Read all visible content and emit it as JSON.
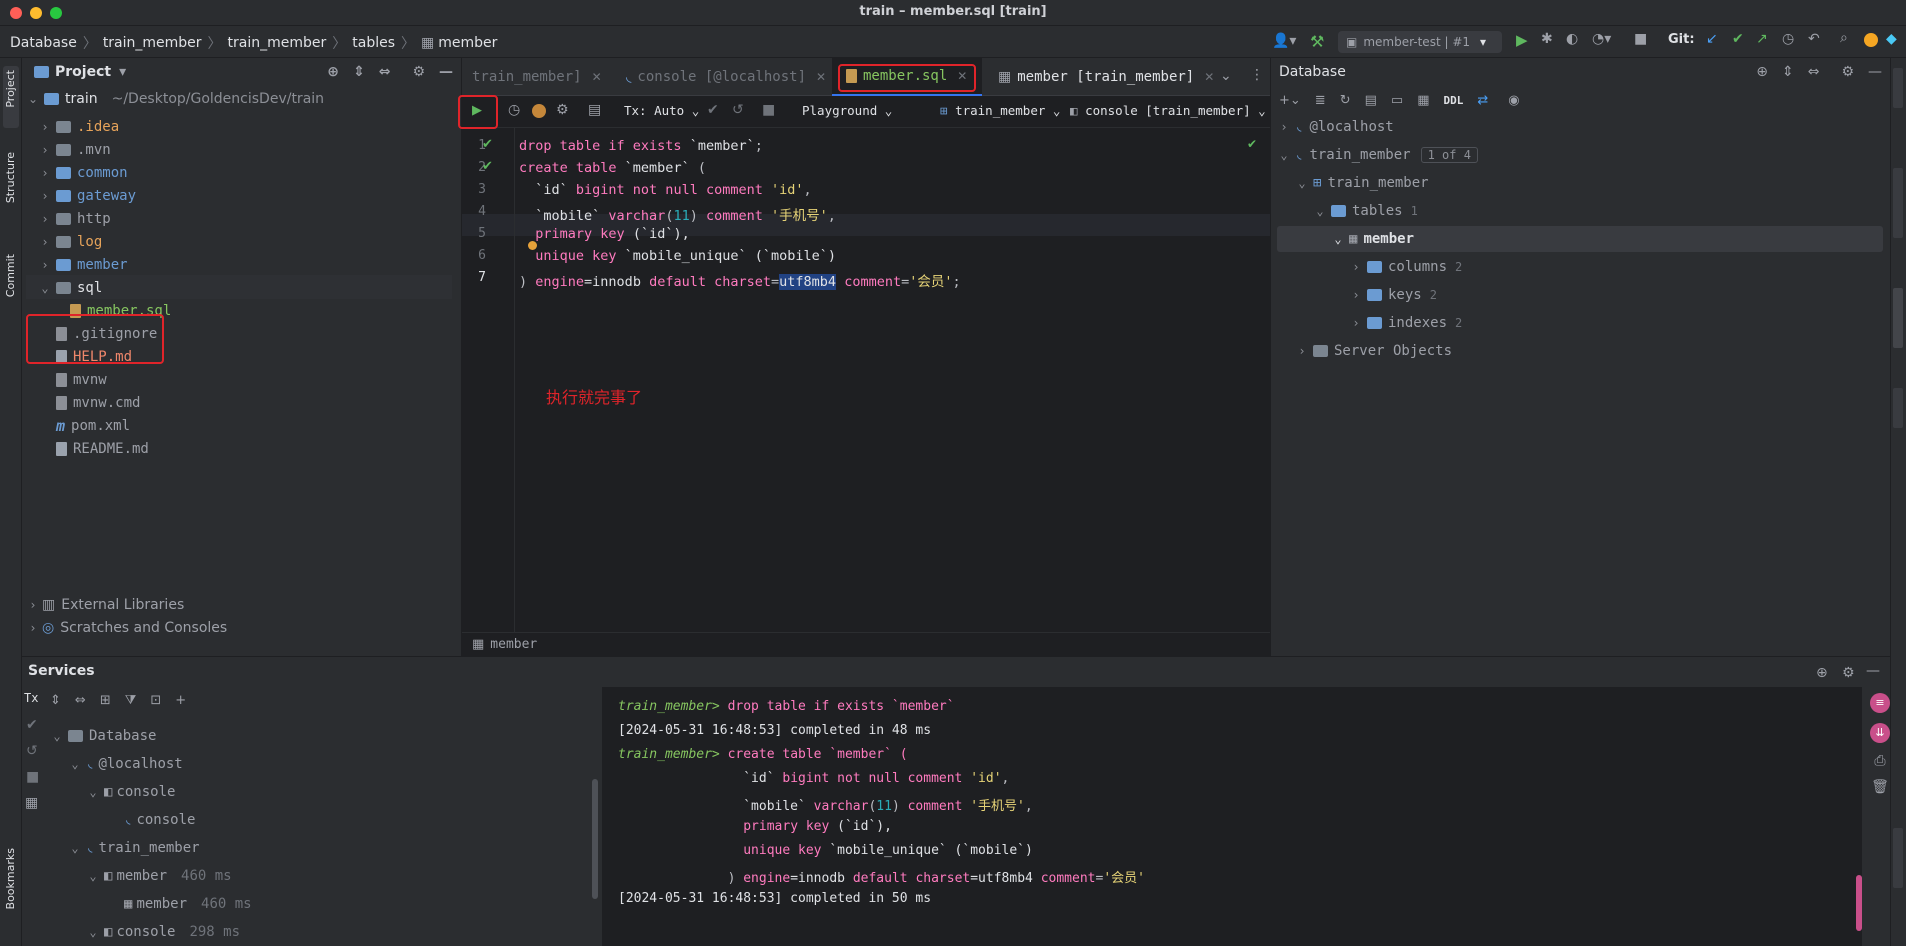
{
  "window": {
    "title": "train – member.sql [train]",
    "traffic_colors": [
      "#ff5f57",
      "#febc2e",
      "#28c840"
    ]
  },
  "navbar": {
    "breadcrumb": [
      "Database",
      "train_member",
      "train_member",
      "tables",
      "member"
    ],
    "run_config": "member-test | #1",
    "git_label": "Git:"
  },
  "left_stripe": {
    "project": "Project",
    "structure": "Structure",
    "commit": "Commit",
    "bookmarks": "Bookmarks"
  },
  "project": {
    "header": "Project",
    "root_name": "train",
    "root_path": "~/Desktop/GoldencisDev/train",
    "items": [
      {
        "label": "idea",
        "display": ".idea",
        "type": "folder",
        "color": "#e6a35a"
      },
      {
        "label": "mvn",
        "display": ".mvn",
        "type": "folder",
        "color": "#9da0a8"
      },
      {
        "label": "common",
        "display": "common",
        "type": "folder",
        "color": "#6b9bd2"
      },
      {
        "label": "gateway",
        "display": "gateway",
        "type": "folder",
        "color": "#6b9bd2"
      },
      {
        "label": "http",
        "display": "http",
        "type": "folder",
        "color": "#9da0a8"
      },
      {
        "label": "log",
        "display": "log",
        "type": "folder",
        "color": "#e6a35a"
      },
      {
        "label": "member",
        "display": "member",
        "type": "folder",
        "color": "#6b9bd2"
      },
      {
        "label": "sql",
        "display": "sql",
        "type": "folder",
        "color": "#dfe1e5"
      },
      {
        "label": "member.sql",
        "display": "member.sql",
        "type": "sqlfile",
        "color": "#86c560"
      },
      {
        "label": "gitignore",
        "display": ".gitignore",
        "type": "file",
        "color": "#9da0a8"
      },
      {
        "label": "HELP.md",
        "display": "HELP.md",
        "type": "md",
        "color": "#f0876b"
      },
      {
        "label": "mvnw",
        "display": "mvnw",
        "type": "file",
        "color": "#9da0a8"
      },
      {
        "label": "mvnw.cmd",
        "display": "mvnw.cmd",
        "type": "file",
        "color": "#9da0a8"
      },
      {
        "label": "pom.xml",
        "display": "pom.xml",
        "type": "m",
        "color": "#9da0a8"
      },
      {
        "label": "README.md",
        "display": "README.md",
        "type": "md",
        "color": "#9da0a8"
      }
    ],
    "external_libraries": "External Libraries",
    "scratches": "Scratches and Consoles"
  },
  "editor": {
    "tabs": [
      {
        "label": "train_member]"
      },
      {
        "label": "console [@localhost]"
      },
      {
        "label": "member.sql"
      },
      {
        "label": "member [train_member]"
      }
    ],
    "toolbar": {
      "tx": "Tx: Auto",
      "playground": "Playground",
      "schema": "train_member",
      "session": "console [train_member]"
    },
    "line_numbers": [
      "1",
      "2",
      "3",
      "4",
      "5",
      "6",
      "7"
    ],
    "annotation": "执行就完事了",
    "breadcrumb_bottom": "member"
  },
  "code": {
    "l1": [
      "drop table if exists ",
      "`member`",
      ";"
    ],
    "l2": [
      "create table ",
      "`member`",
      " ("
    ],
    "l3": [
      "  `id` ",
      "bigint not null comment ",
      "'id'",
      ","
    ],
    "l4": [
      "  `mobile` ",
      "varchar",
      "(",
      "11",
      ") ",
      "comment ",
      "'手机号'",
      ","
    ],
    "l5": [
      "  ",
      "primary key ",
      "(`id`),"
    ],
    "l6": [
      "  ",
      "unique key ",
      "`mobile_unique` (`mobile`)"
    ],
    "l7": [
      ") ",
      "engine",
      "=innodb ",
      "default charset",
      "=",
      "utf8mb4",
      " ",
      "comment",
      "=",
      "'会员'",
      ";"
    ]
  },
  "database": {
    "header": "Database",
    "ddl": "DDL",
    "localhost": "@localhost",
    "train_member": "train_member",
    "badge": "1 of 4",
    "schema": "train_member",
    "tables": "tables",
    "tables_count": "1",
    "member": "member",
    "columns": "columns",
    "columns_count": "2",
    "keys": "keys",
    "keys_count": "2",
    "indexes": "indexes",
    "indexes_count": "2",
    "server_objects": "Server Objects"
  },
  "services": {
    "header": "Services",
    "tx": "Tx",
    "tree": {
      "database": "Database",
      "localhost": "@localhost",
      "console": "console",
      "console_child": "console",
      "train_member": "train_member",
      "member_session": "member",
      "member_session_time": "460 ms",
      "member_table": "member",
      "member_table_time": "460 ms",
      "console2": "console",
      "console2_time": "298 ms"
    },
    "output": {
      "p1": "train_member>",
      "c1": " drop table if exists `member`",
      "t1": "[2024-05-31 16:48:53] completed in 48 ms",
      "p2": "train_member>",
      "c2": " create table `member` (",
      "o3a": "                `id` ",
      "o3b": "bigint not null comment ",
      "o3c": "'id'",
      "o3d": ",",
      "o4a": "                `mobile` ",
      "o4b": "varchar",
      "o4c": "(",
      "o4d": "11",
      "o4e": ") ",
      "o4f": "comment ",
      "o4g": "'手机号'",
      "o4h": ",",
      "o5a": "                ",
      "o5b": "primary key ",
      "o5c": "(`id`),",
      "o6a": "                ",
      "o6b": "unique key ",
      "o6c": "`mobile_unique` (`mobile`)",
      "o7a": "              ) ",
      "o7b": "engine",
      "o7c": "=innodb ",
      "o7d": "default charset",
      "o7e": "=utf8mb4 ",
      "o7f": "comment",
      "o7g": "=",
      "o7h": "'会员'",
      "t2": "[2024-05-31 16:48:53] completed in 50 ms"
    }
  }
}
